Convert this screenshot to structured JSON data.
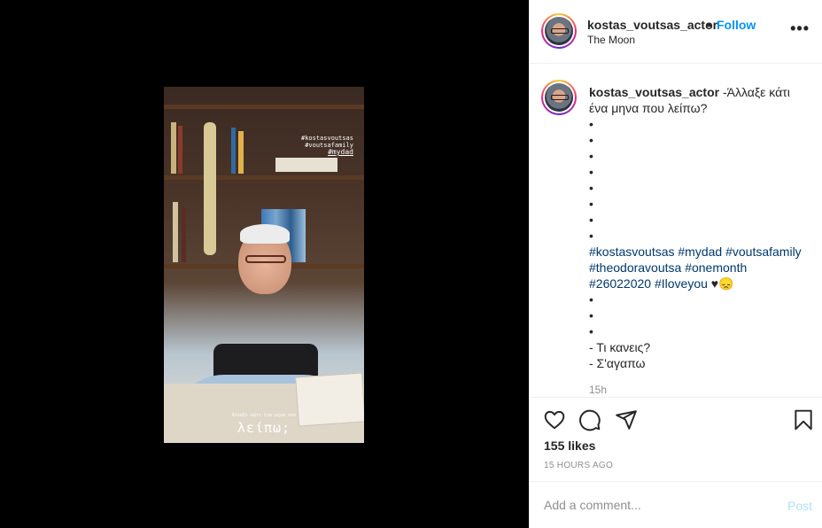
{
  "post": {
    "username": "kostas_voutsas_actor",
    "follow_label": "Follow",
    "separator": "•",
    "location": "The Moon",
    "more_label": "•••"
  },
  "video": {
    "tags": [
      "#kostasvoutsas",
      "#voutsafamily"
    ],
    "main_tag": "#mydad",
    "caption_small": "Άλλαξε κάτι ένα μηνα που",
    "caption_big": "λείπω;"
  },
  "caption": {
    "username": "kostas_voutsas_actor",
    "first_line": " -Άλλαξε κάτι ένα μηνα που λείπω?",
    "bullets_top": [
      "•",
      "•",
      "•",
      "•",
      "•",
      "•",
      "•",
      "•"
    ],
    "hashtags_line1": "#kostasvoutsas #mydad #voutsafamily",
    "hashtags_line2": "#theodoravoutsa #onemonth",
    "hashtags_line3_tag": "#26022020 #Iloveyou",
    "hashtags_line3_suffix": " ♥😞",
    "bullets_bottom": [
      "•",
      "•",
      "•"
    ],
    "reply1": "- Τι κανεις?",
    "reply2": "- Σ'αγαπω",
    "time_ago": "15h"
  },
  "actions": {
    "likes": "155 likes",
    "timestamp": "15 HOURS AGO"
  },
  "comment_box": {
    "placeholder": "Add a comment...",
    "post_label": "Post"
  }
}
